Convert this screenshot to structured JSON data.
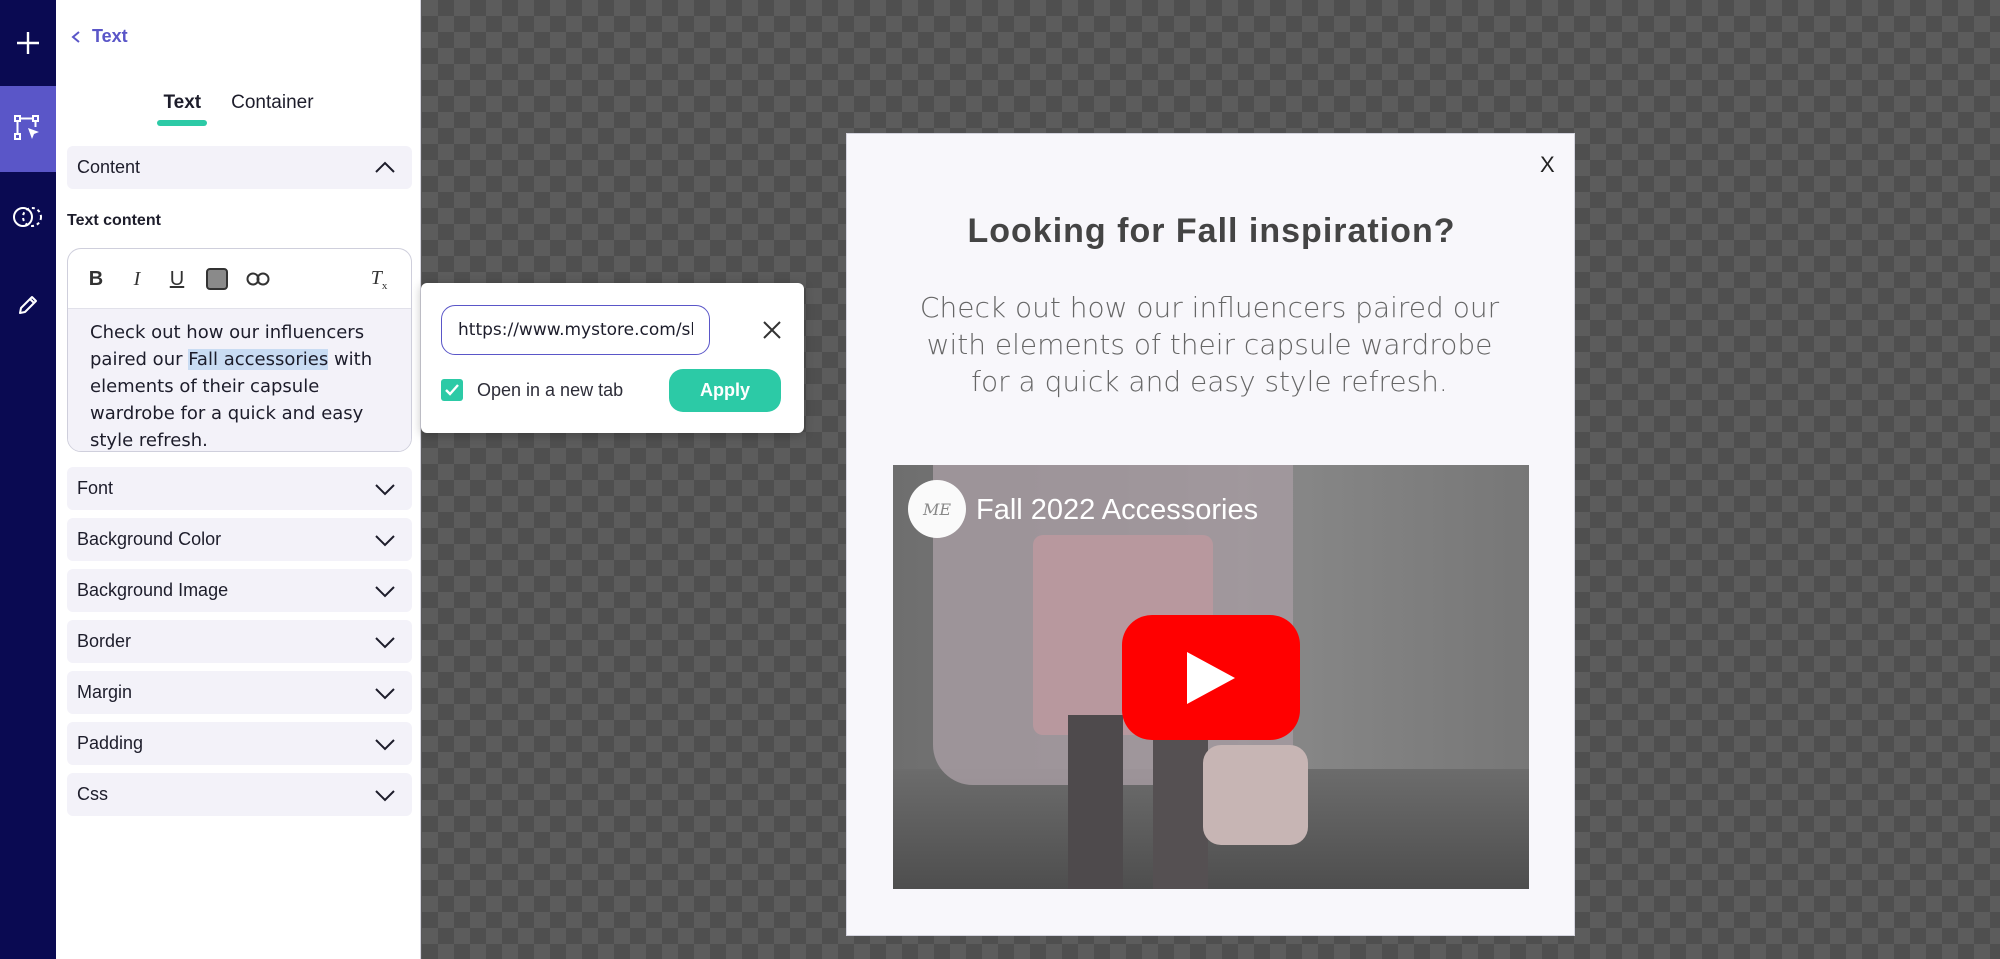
{
  "rail": {
    "items": [
      {
        "name": "add",
        "icon": "plus-icon"
      },
      {
        "name": "select",
        "icon": "select-cursor-icon"
      },
      {
        "name": "shapes",
        "icon": "shapes-icon"
      },
      {
        "name": "edit",
        "icon": "pencil-icon"
      }
    ]
  },
  "panel": {
    "back_label": "Text",
    "tabs": [
      {
        "label": "Text",
        "active": true
      },
      {
        "label": "Container",
        "active": false
      }
    ],
    "content_section": "Content",
    "text_content_label": "Text content",
    "editor": {
      "text_before": "Check out how our influencers paired our ",
      "text_selected": "Fall accessories",
      "text_after": " with elements of their capsule wardrobe for a quick and easy style refresh.",
      "toolbar": [
        "bold",
        "italic",
        "underline",
        "color",
        "link",
        "clear-format"
      ]
    },
    "sections": [
      "Font",
      "Background Color",
      "Background Image",
      "Border",
      "Margin",
      "Padding",
      "Css"
    ]
  },
  "link_popover": {
    "url_value": "https://www.mystore.com/shop/",
    "open_new_tab_label": "Open in a new tab",
    "open_new_tab_checked": true,
    "apply_label": "Apply"
  },
  "popup": {
    "close_label": "X",
    "headline": "Looking for Fall inspiration?",
    "body": "Check out how our influencers paired our with elements of their capsule wardrobe for a quick and easy style refresh.",
    "video": {
      "title": "Fall 2022 Accessories",
      "channel_badge": "ME"
    }
  },
  "colors": {
    "rail": "#0a0a52",
    "rail_active": "#5a56c8",
    "accent": "#2ccaa6",
    "link": "#5a56c8"
  }
}
